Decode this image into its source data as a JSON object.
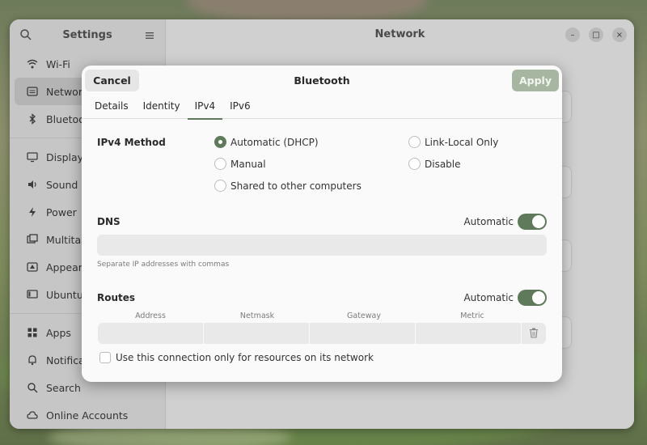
{
  "settings": {
    "sidebar_title": "Settings",
    "page_title": "Network",
    "items_group1": [
      {
        "label": "Wi-Fi",
        "icon": "wifi-icon"
      },
      {
        "label": "Network",
        "icon": "network-icon",
        "active": true
      },
      {
        "label": "Bluetooth",
        "icon": "bluetooth-icon"
      }
    ],
    "items_group2": [
      {
        "label": "Displays",
        "icon": "display-icon"
      },
      {
        "label": "Sound",
        "icon": "sound-icon"
      },
      {
        "label": "Power",
        "icon": "power-icon"
      },
      {
        "label": "Multitasking",
        "icon": "multitasking-icon"
      },
      {
        "label": "Appearance",
        "icon": "appearance-icon"
      },
      {
        "label": "Ubuntu Desktop",
        "icon": "ubuntu-desktop-icon"
      }
    ],
    "items_group3": [
      {
        "label": "Apps",
        "icon": "apps-icon"
      },
      {
        "label": "Notifications",
        "icon": "notifications-icon"
      },
      {
        "label": "Search",
        "icon": "search-icon"
      },
      {
        "label": "Online Accounts",
        "icon": "online-accounts-icon"
      }
    ],
    "window_controls": {
      "minimize": "–",
      "maximize": "□",
      "close": "×"
    }
  },
  "dialog": {
    "cancel_label": "Cancel",
    "title": "Bluetooth",
    "apply_label": "Apply",
    "tabs": [
      "Details",
      "Identity",
      "IPv4",
      "IPv6"
    ],
    "active_tab": "IPv4",
    "ipv4_method_label": "IPv4 Method",
    "methods": {
      "automatic": "Automatic (DHCP)",
      "manual": "Manual",
      "shared": "Shared to other computers",
      "link_local": "Link-Local Only",
      "disable": "Disable"
    },
    "selected_method": "Automatic (DHCP)",
    "dns": {
      "label": "DNS",
      "automatic_label": "Automatic",
      "automatic_on": true,
      "value": "",
      "hint": "Separate IP addresses with commas"
    },
    "routes": {
      "label": "Routes",
      "automatic_label": "Automatic",
      "automatic_on": true,
      "columns": [
        "Address",
        "Netmask",
        "Gateway",
        "Metric"
      ]
    },
    "checkbox_label": "Use this connection only for resources on its network",
    "checkbox_checked": false
  },
  "colors": {
    "accent": "#5e7a5a",
    "apply_disabled": "#a7b6a1"
  }
}
